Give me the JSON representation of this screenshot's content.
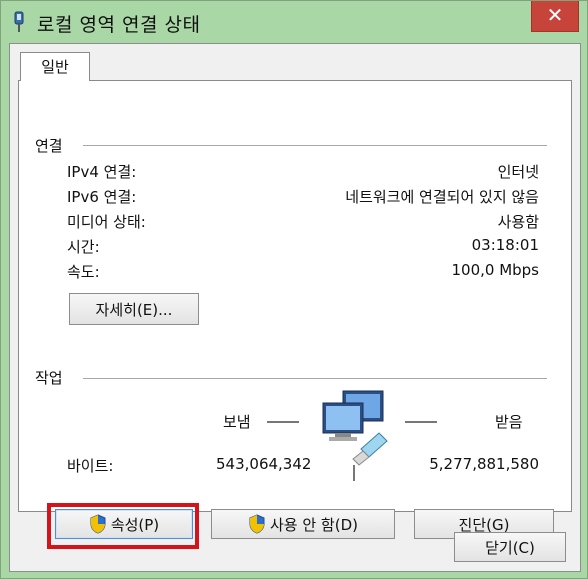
{
  "window": {
    "title": "로컬 영역 연결 상태",
    "close_glyph": "✕"
  },
  "tabs": [
    {
      "label": "일반"
    }
  ],
  "connection": {
    "group_title": "연결",
    "rows": [
      {
        "label": "IPv4 연결:",
        "value": "인터넷"
      },
      {
        "label": "IPv6 연결:",
        "value": "네트워크에 연결되어 있지 않음"
      },
      {
        "label": "미디어 상태:",
        "value": "사용함"
      },
      {
        "label": "시간:",
        "value": "03:18:01"
      },
      {
        "label": "속도:",
        "value": "100,0 Mbps"
      }
    ],
    "details_button": "자세히(E)..."
  },
  "activity": {
    "group_title": "작업",
    "sent_label": "보냄",
    "received_label": "받음",
    "bytes_label": "바이트:",
    "bytes_sent": "543,064,342",
    "bytes_received": "5,277,881,580"
  },
  "actions": {
    "properties": "속성(P)",
    "disable": "사용 안 함(D)",
    "diagnose": "진단(G)"
  },
  "footer": {
    "close": "닫기(C)"
  },
  "colors": {
    "frame": "#a9d7a6",
    "close_button": "#c7443a",
    "highlight_box": "#d4141a",
    "shield_blue": "#2d6fcc",
    "shield_yellow": "#f2c200"
  },
  "icons": {
    "title": "network-adapter-icon",
    "activity": "network-computers-icon",
    "uac": "uac-shield-icon"
  }
}
